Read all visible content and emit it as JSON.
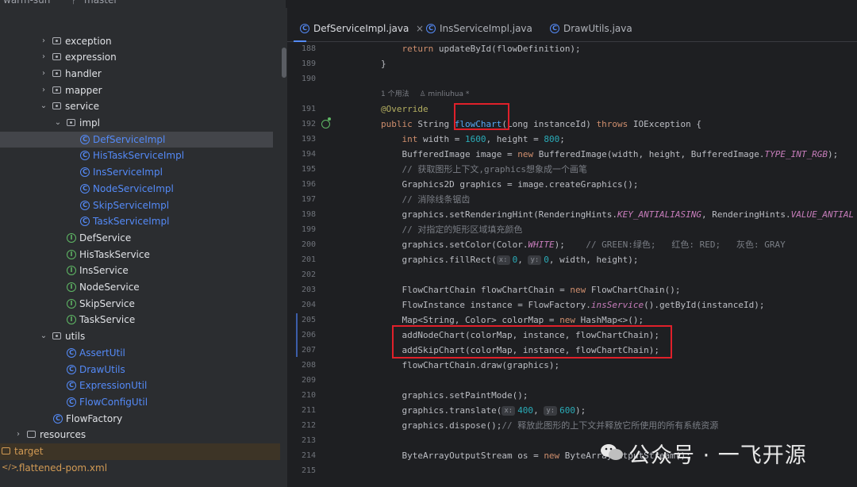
{
  "topbar": {
    "project": "warm-sun",
    "branch": "master"
  },
  "tree": [
    {
      "label": "exception",
      "type": "package",
      "arrow": "›"
    },
    {
      "label": "expression",
      "type": "package",
      "arrow": "›"
    },
    {
      "label": "handler",
      "type": "package",
      "arrow": "›"
    },
    {
      "label": "mapper",
      "type": "package",
      "arrow": "›"
    },
    {
      "label": "service",
      "type": "package",
      "arrow": "⌄"
    },
    {
      "label": "impl",
      "type": "package",
      "arrow": "⌄"
    },
    {
      "label": "DefServiceImpl",
      "type": "class"
    },
    {
      "label": "HisTaskServiceImpl",
      "type": "class"
    },
    {
      "label": "InsServiceImpl",
      "type": "class"
    },
    {
      "label": "NodeServiceImpl",
      "type": "class"
    },
    {
      "label": "SkipServiceImpl",
      "type": "class"
    },
    {
      "label": "TaskServiceImpl",
      "type": "class"
    },
    {
      "label": "DefService",
      "type": "interface"
    },
    {
      "label": "HisTaskService",
      "type": "interface"
    },
    {
      "label": "InsService",
      "type": "interface"
    },
    {
      "label": "NodeService",
      "type": "interface"
    },
    {
      "label": "SkipService",
      "type": "interface"
    },
    {
      "label": "TaskService",
      "type": "interface"
    },
    {
      "label": "utils",
      "type": "package",
      "arrow": "⌄"
    },
    {
      "label": "AssertUtil",
      "type": "class"
    },
    {
      "label": "DrawUtils",
      "type": "class"
    },
    {
      "label": "ExpressionUtil",
      "type": "class"
    },
    {
      "label": "FlowConfigUtil",
      "type": "class"
    },
    {
      "label": "FlowFactory",
      "type": "class"
    },
    {
      "label": "resources",
      "type": "folder",
      "arrow": "›"
    },
    {
      "label": "target",
      "type": "folder"
    },
    {
      "label": ".flattened-pom.xml",
      "type": "xml"
    }
  ],
  "tabs": [
    {
      "label": "DefServiceImpl.java",
      "close": "×"
    },
    {
      "label": "InsServiceImpl.java"
    },
    {
      "label": "DrawUtils.java"
    }
  ],
  "usage_hint": {
    "usages": "1 个用法",
    "author": "minliuhua *"
  },
  "line_numbers": [
    "188",
    "189",
    "190",
    "191",
    "192",
    "193",
    "194",
    "195",
    "196",
    "197",
    "198",
    "199",
    "200",
    "201",
    "202",
    "203",
    "204",
    "205",
    "206",
    "207",
    "208",
    "209",
    "210",
    "211",
    "212",
    "213",
    "214",
    "215"
  ],
  "hints": {
    "x": "x:",
    "y": "y:"
  },
  "code": {
    "l188_kw": "return",
    "l188_rest": " updateById(flowDefinition);",
    "l189": "}",
    "l191": "@Override",
    "l192_kw1": "public",
    "l192_t": " String ",
    "l192_fn": "flowChart",
    "l192_p": "(Long instanceId) ",
    "l192_kw2": "throws",
    "l192_e": " IOException {",
    "l193_kw": "int",
    "l193_a": " width = ",
    "l193_n1": "1600",
    "l193_b": ", height = ",
    "l193_n2": "800",
    "l193_c": ";",
    "l194_a": "BufferedImage image = ",
    "l194_kw": "new",
    "l194_b": " BufferedImage(width, height, BufferedImage.",
    "l194_st": "TYPE_INT_RGB",
    "l194_c": ");",
    "l195": "// 获取图形上下文,graphics想象成一个画笔",
    "l196": "Graphics2D graphics = image.createGraphics();",
    "l197": "// 消除线条锯齿",
    "l198_a": "graphics.setRenderingHint(RenderingHints.",
    "l198_st1": "KEY_ANTIALIASING",
    "l198_b": ", RenderingHints.",
    "l198_st2": "VALUE_ANTIAL",
    "l199": "// 对指定的矩形区域填充颜色",
    "l200_a": "graphics.setColor(Color.",
    "l200_st": "WHITE",
    "l200_b": ");",
    "l200_cm": "    // GREEN:绿色;   红色: RED;   灰色: GRAY",
    "l201_a": "graphics.fillRect(",
    "l201_n1": "0",
    "l201_b": ", ",
    "l201_n2": "0",
    "l201_c": ", width, height);",
    "l203_a": "FlowChartChain flowChartChain = ",
    "l203_kw": "new",
    "l203_b": " FlowChartChain();",
    "l204_a": "FlowInstance instance = FlowFactory.",
    "l204_st": "insService",
    "l204_b": "().getById(instanceId);",
    "l205_a": "Map<String, Color> colorMap = ",
    "l205_kw": "new",
    "l205_b": " HashMap<>();",
    "l206": "addNodeChart(colorMap, instance, flowChartChain);",
    "l207": "addSkipChart(colorMap, instance, flowChartChain);",
    "l208": "flowChartChain.draw(graphics);",
    "l210": "graphics.setPaintMode();",
    "l211_a": "graphics.translate(",
    "l211_n1": "400",
    "l211_b": ", ",
    "l211_n2": "600",
    "l211_c": ");",
    "l212_a": "graphics.dispose();",
    "l212_cm": "// 释放此图形的上下文并释放它所使用的所有系统资源",
    "l214_a": "ByteArrayOutputStream os = ",
    "l214_kw": "new",
    "l214_b": " ByteArrayOutputStream();"
  },
  "watermark": "公众号 · 一飞开源",
  "colors": {
    "highlight_box": "#e0202a",
    "accent": "#548af7"
  }
}
